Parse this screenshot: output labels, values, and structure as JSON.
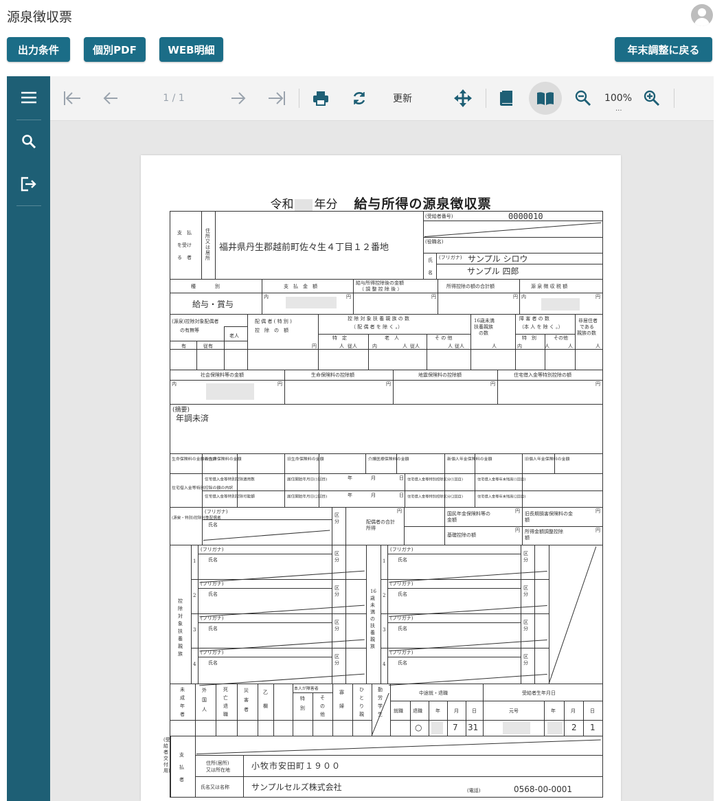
{
  "app": {
    "title": "源泉徴収票"
  },
  "header_buttons": {
    "output_conditions": "出力条件",
    "individual_pdf": "個別PDF",
    "web_detail": "WEB明細",
    "back": "年末調整に戻る"
  },
  "sidebar": {
    "items": [
      "menu-icon",
      "search-icon",
      "logout-icon"
    ]
  },
  "viewer_toolbar": {
    "page_indicator": "1 / 1",
    "refresh_label": "更新",
    "zoom": "100%",
    "zoom_more": "..."
  },
  "document": {
    "title_era": "令和",
    "title_year_suffix": "年分",
    "title_main": "給与所得の源泉徴収票",
    "payee_number_label": "(受給者番号)",
    "payee_number": "0000010",
    "position_label": "(役職名)",
    "payee_label_1": "支　払",
    "payee_label_2": "を受け",
    "payee_label_3": "る　者",
    "address_label": "住所又は居所",
    "payee_address": "福井県丹生郡越前町佐々生４丁目１２番地",
    "name_label_1": "氏",
    "name_label_2": "名",
    "furigana_label": "(フリガナ)",
    "furigana": "サンプル シロウ",
    "name": "サンプル 四郎",
    "col_type": "種　　　　別",
    "col_payment": "支　払　金　額",
    "col_after_deduction": "給与所得控除後の金額",
    "col_after_deduction_sub": "（ 調 整 控 除 後 ）",
    "col_total_deductions": "所得控除の額の合計額",
    "col_withholding": "源 泉 徴 収 税 額",
    "income_type": "給与・賞与",
    "yen": "円",
    "inner": "内",
    "spouse_label_1": "(源泉)控除対象配偶者",
    "spouse_label_2": "の有無等",
    "spouse_old": "老人",
    "spouse_special_1": "配 偶 者 ( 特 別 )",
    "spouse_special_2": "控　除　の　額",
    "dependents_1": "控 除 対 象 扶 養 親 族 の 数",
    "dependents_2": "（ 配 偶 者 を 除 く 。）",
    "dep_specific": "特　定",
    "dep_old": "老　人",
    "dep_other": "そ の 他",
    "under16_1": "16歳未満",
    "under16_2": "扶養親族",
    "under16_3": "の数",
    "disabled_1": "障 害 者 の 数",
    "disabled_2": "（本 人 を 除 く 。）",
    "disabled_special": "特　別",
    "disabled_other": "その他",
    "nonresident_1": "非居住者",
    "nonresident_2": "である",
    "nonresident_3": "親族の数",
    "has": "有",
    "cohabit": "従有",
    "person": "人",
    "cohabit_short": "従人",
    "social_insurance": "社会保険料等の金額",
    "life_insurance": "生命保険料の控除額",
    "earthquake_insurance": "地震保険料の控除額",
    "housing_loan": "住宅借入金等特別控除の額",
    "remarks_label": "(摘要)",
    "remarks": "年調未済",
    "life_breakdown": "生命保険料の金額の内訳",
    "new_life": "新生命保険料の金額",
    "old_life": "旧生命保険料の金額",
    "care_medical": "介護医療保険料の金額",
    "new_pension": "新個人年金保険料の金額",
    "old_pension": "旧個人年金保険料の金額",
    "housing_breakdown": "住宅借入金等特別控除の額の内訳",
    "housing_eligible": "住宅借入金等特別控除適用数",
    "housing_start_1": "居住開始年月日(1回目)",
    "housing_start_2": "居住開始年月日(2回目)",
    "housing_type_1": "住宅借入金等特別控除区分(1回目)",
    "housing_type_2": "住宅借入金等特別控除区分(2回目)",
    "housing_balance_1": "住宅借入金等年末残高(1回目)",
    "housing_balance_2": "住宅借入金等年末残高(2回目)",
    "housing_possible": "住宅借入金等特別控除可能額",
    "year": "年",
    "month": "月",
    "day": "日",
    "spouse_target": "(源泉・特別)控除対象配偶者",
    "name_short": "氏名",
    "category": "区分",
    "spouse_income": "配偶者の合計所得",
    "national_pension": "国民年金保険料等の金額",
    "old_longterm": "旧長期損害保険料の金額",
    "basic_deduction": "基礎控除の額",
    "income_adjust": "所得金額調整控除額",
    "dep_target_label": "控除対象扶養親族",
    "under16_label": "16歳未満の扶養親族",
    "row_no_1": "1",
    "row_no_2": "2",
    "row_no_3": "3",
    "row_no_4": "4",
    "minor": "未成年者",
    "foreigner": "外国人",
    "deceased": "死亡退職",
    "disaster": "災害者",
    "otsu": "乙欄",
    "self_disabled": "本人が障害者",
    "special": "特別",
    "other": "その他",
    "widow": "寡婦",
    "single_parent": "ひとり親",
    "working_student": "勤労学生",
    "midyear": "中途就・退職",
    "hired": "就職",
    "retired": "退職",
    "era_col": "元号",
    "birth": "受給者生年月日",
    "retired_mark": "○",
    "retire_month": "7",
    "retire_day": "31",
    "birth_month": "2",
    "birth_day": "1",
    "payer_side": "(受給者交付用)",
    "payer_label": "支払者",
    "payer_address_label_1": "住所(居所)",
    "payer_address_label_2": "又は所在地",
    "payer_address": "小牧市安田町１９００",
    "payer_name_label": "氏名又は名称",
    "payer_name": "サンプルセルズ株式会社",
    "phone_label": "(電話)",
    "phone": "0568-00-0001"
  }
}
